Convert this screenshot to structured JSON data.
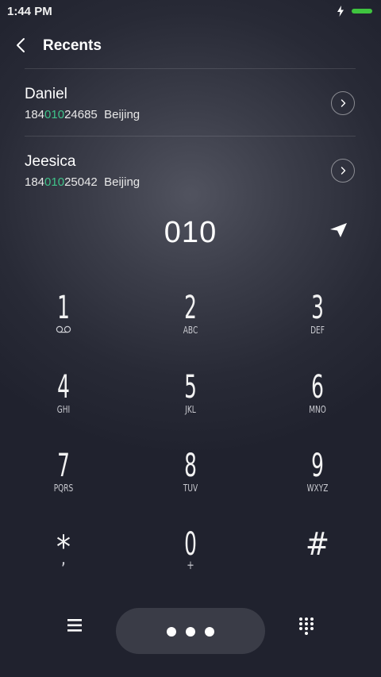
{
  "status_bar": {
    "time": "1:44 PM",
    "charging_icon": "lightning-icon",
    "battery_color": "#3fc43f"
  },
  "header": {
    "title": "Recents",
    "back_icon": "back-arrow-icon"
  },
  "recents": [
    {
      "name": "Daniel",
      "number_prefix": "184",
      "number_match": "010",
      "number_suffix": "24685",
      "location": "Beijing"
    },
    {
      "name": "Jeesica",
      "number_prefix": "184",
      "number_match": "010",
      "number_suffix": "25042",
      "location": "Beijing"
    }
  ],
  "dialer": {
    "dialed_number": "010",
    "send_icon": "send-arrow-icon"
  },
  "keypad": [
    {
      "digit": "1",
      "sub": "",
      "icon": "voicemail-icon"
    },
    {
      "digit": "2",
      "sub": "ABC"
    },
    {
      "digit": "3",
      "sub": "DEF"
    },
    {
      "digit": "4",
      "sub": "GHI"
    },
    {
      "digit": "5",
      "sub": "JKL"
    },
    {
      "digit": "6",
      "sub": "MNO"
    },
    {
      "digit": "7",
      "sub": "PQRS"
    },
    {
      "digit": "8",
      "sub": "TUV"
    },
    {
      "digit": "9",
      "sub": "WXYZ"
    },
    {
      "digit": "*",
      "sub": ","
    },
    {
      "digit": "0",
      "sub": "+"
    },
    {
      "digit": "#",
      "sub": ""
    }
  ],
  "bottom_bar": {
    "menu_icon": "hamburger-menu-icon",
    "call_icon": "more-dots-icon",
    "keypad_icon": "dialpad-icon"
  },
  "colors": {
    "accent_green": "#3fc48a",
    "background": "#20222e",
    "pill": "#3a3c47"
  }
}
